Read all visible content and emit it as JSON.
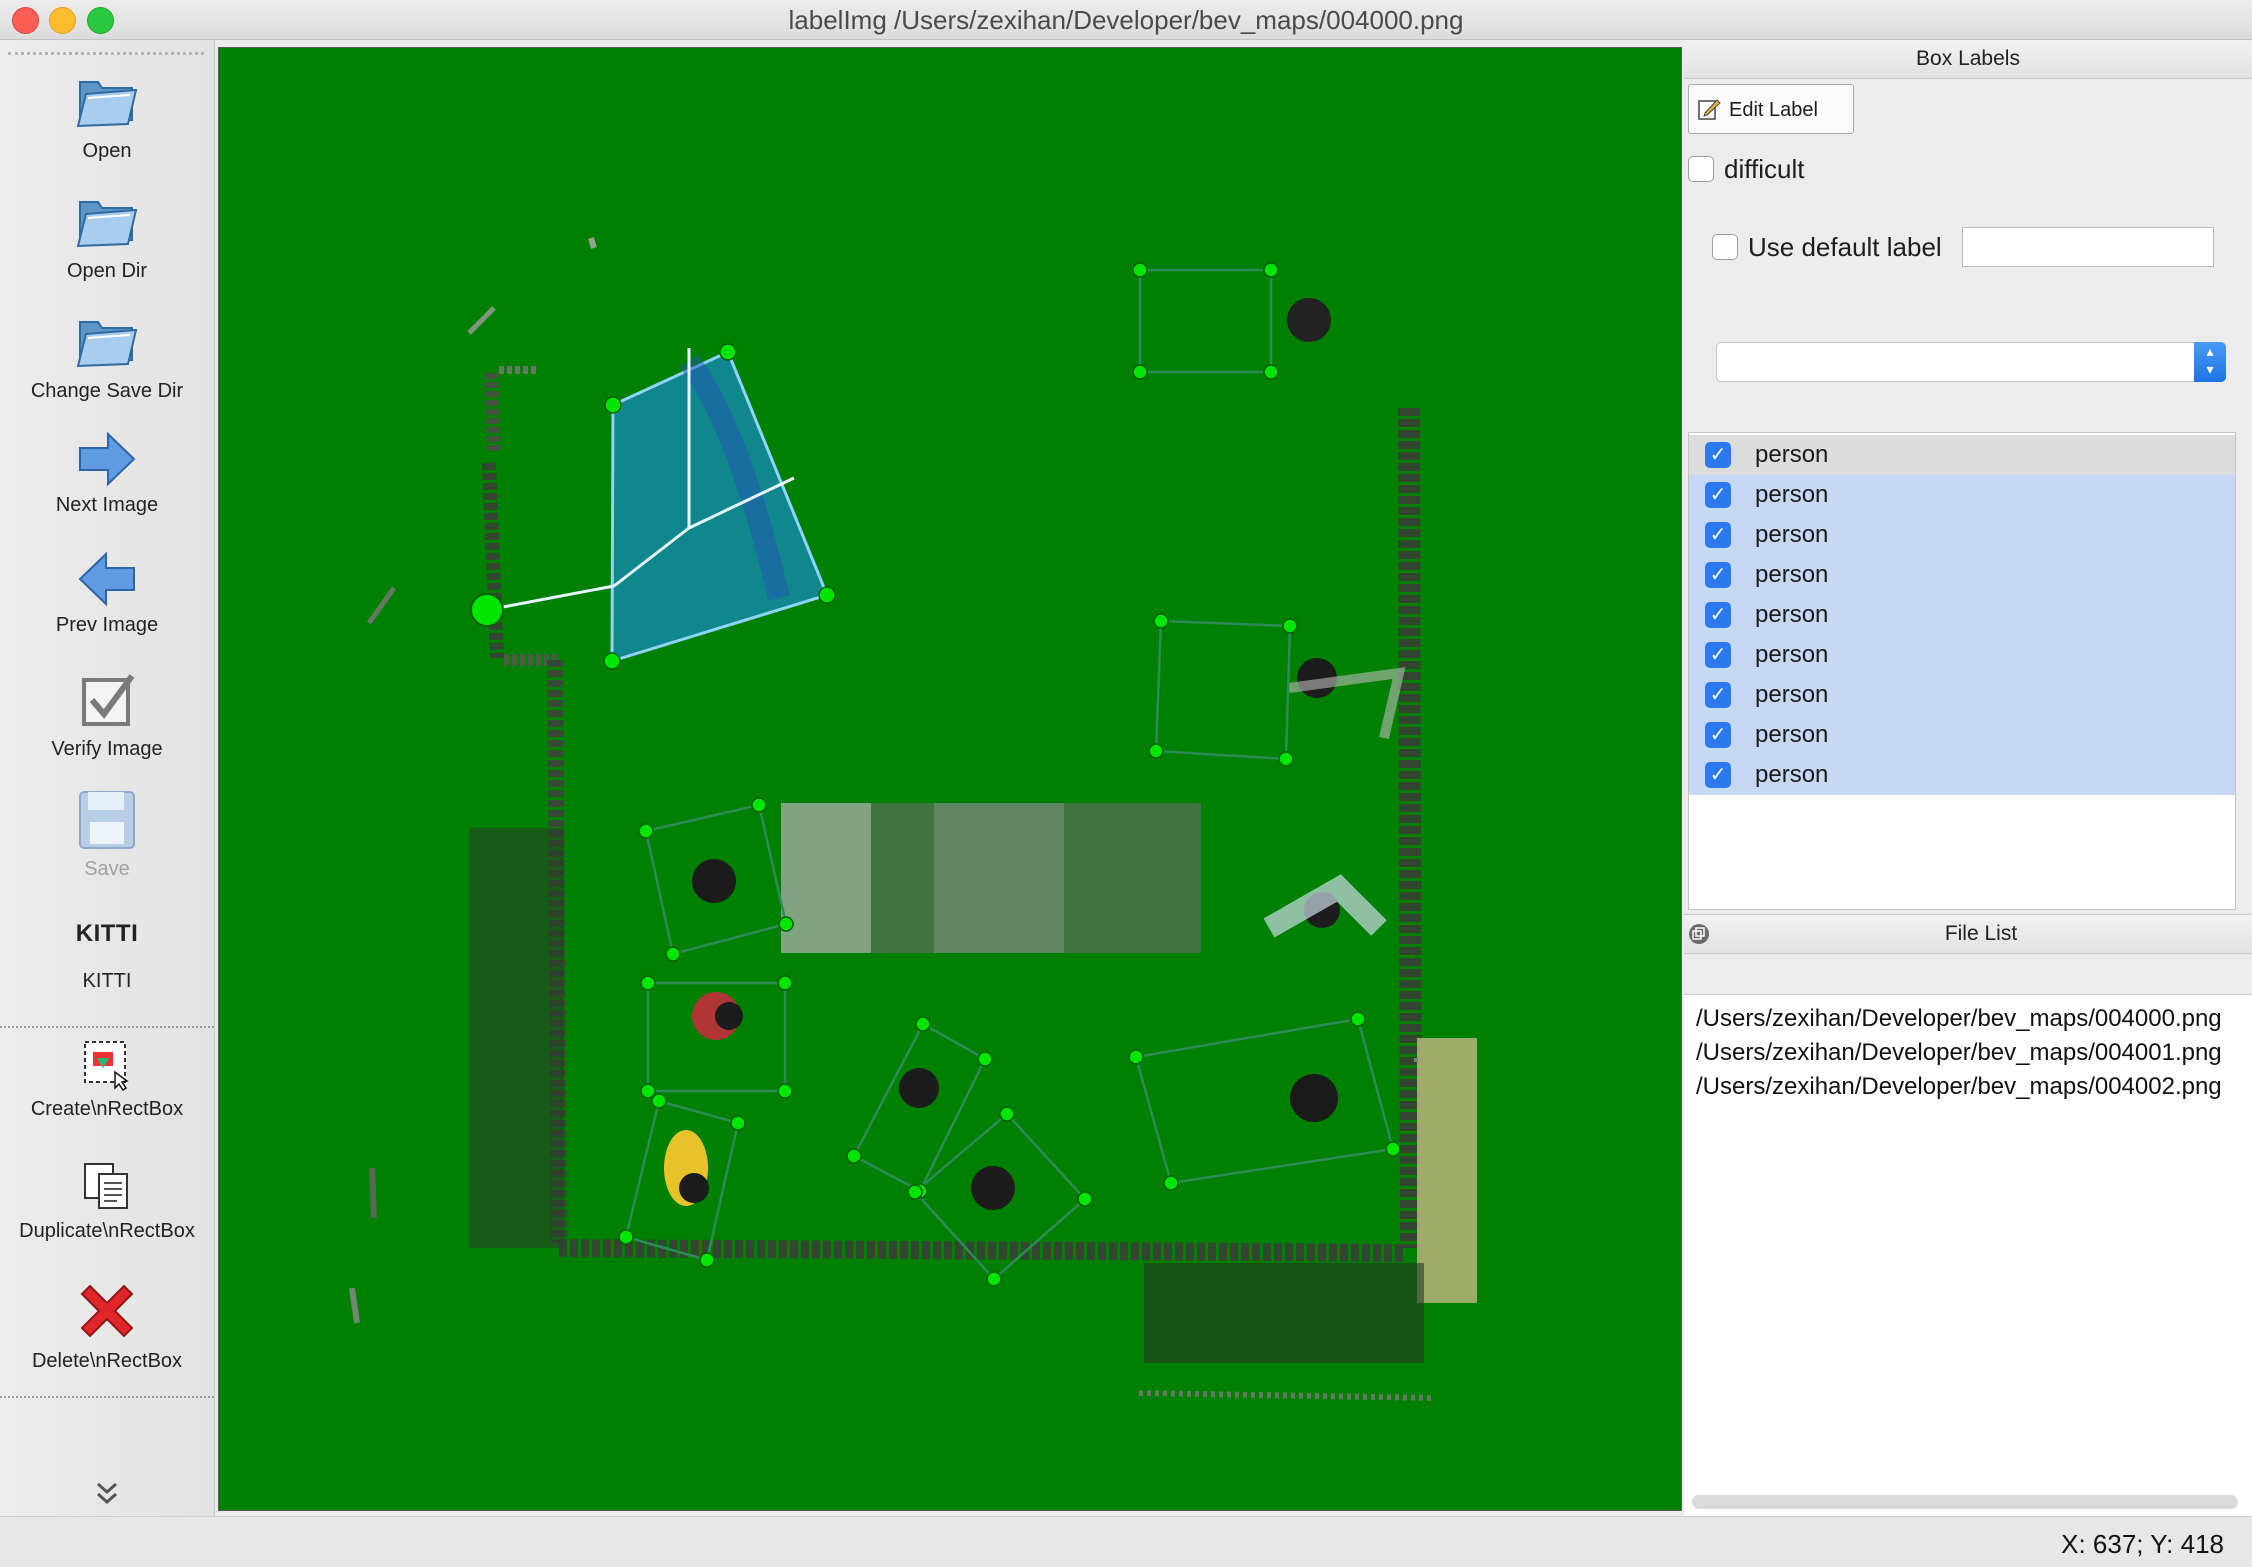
{
  "window": {
    "title": "labelImg /Users/zexihan/Developer/bev_maps/004000.png"
  },
  "toolbar": {
    "items": [
      {
        "label": "Open",
        "icon": "folder-open-icon",
        "enabled": true
      },
      {
        "label": "Open Dir",
        "icon": "folder-open-icon",
        "enabled": true
      },
      {
        "label": "Change Save Dir",
        "icon": "folder-open-icon",
        "enabled": true
      },
      {
        "label": "Next Image",
        "icon": "arrow-right-icon",
        "enabled": true
      },
      {
        "label": "Prev Image",
        "icon": "arrow-left-icon",
        "enabled": true
      },
      {
        "label": "Verify Image",
        "icon": "verify-check-icon",
        "enabled": true
      },
      {
        "label": "Save",
        "icon": "floppy-save-icon",
        "enabled": false
      },
      {
        "label": "KITTI",
        "icon_text": "KITTI",
        "enabled": true
      },
      {
        "label": "Create\\nRectBox",
        "icon": "create-rectbox-icon",
        "enabled": true
      },
      {
        "label": "Duplicate\\nRectBox",
        "icon": "duplicate-rectbox-icon",
        "enabled": true
      },
      {
        "label": "Delete\\nRectBox",
        "icon": "delete-x-icon",
        "enabled": true
      }
    ],
    "more_icon": "chevron-double-down-icon"
  },
  "canvas": {
    "background_color": "#008000",
    "box_color": "#00ff00",
    "selected_fill_color": "#1e90ff"
  },
  "box_labels_panel": {
    "header": "Box Labels",
    "edit_label_button": "Edit Label",
    "difficult_label": "difficult",
    "difficult_checked": false,
    "use_default_label": "Use default label",
    "use_default_checked": false,
    "default_label_value": "",
    "label_combo_value": "",
    "labels": [
      {
        "text": "person",
        "checked": true
      },
      {
        "text": "person",
        "checked": true
      },
      {
        "text": "person",
        "checked": true
      },
      {
        "text": "person",
        "checked": true
      },
      {
        "text": "person",
        "checked": true
      },
      {
        "text": "person",
        "checked": true
      },
      {
        "text": "person",
        "checked": true
      },
      {
        "text": "person",
        "checked": true
      },
      {
        "text": "person",
        "checked": true
      }
    ]
  },
  "file_list_panel": {
    "header": "File List",
    "files": [
      "/Users/zexihan/Developer/bev_maps/004000.png",
      "/Users/zexihan/Developer/bev_maps/004001.png",
      "/Users/zexihan/Developer/bev_maps/004002.png"
    ]
  },
  "status_bar": {
    "cursor_position": "X: 637; Y: 418"
  }
}
